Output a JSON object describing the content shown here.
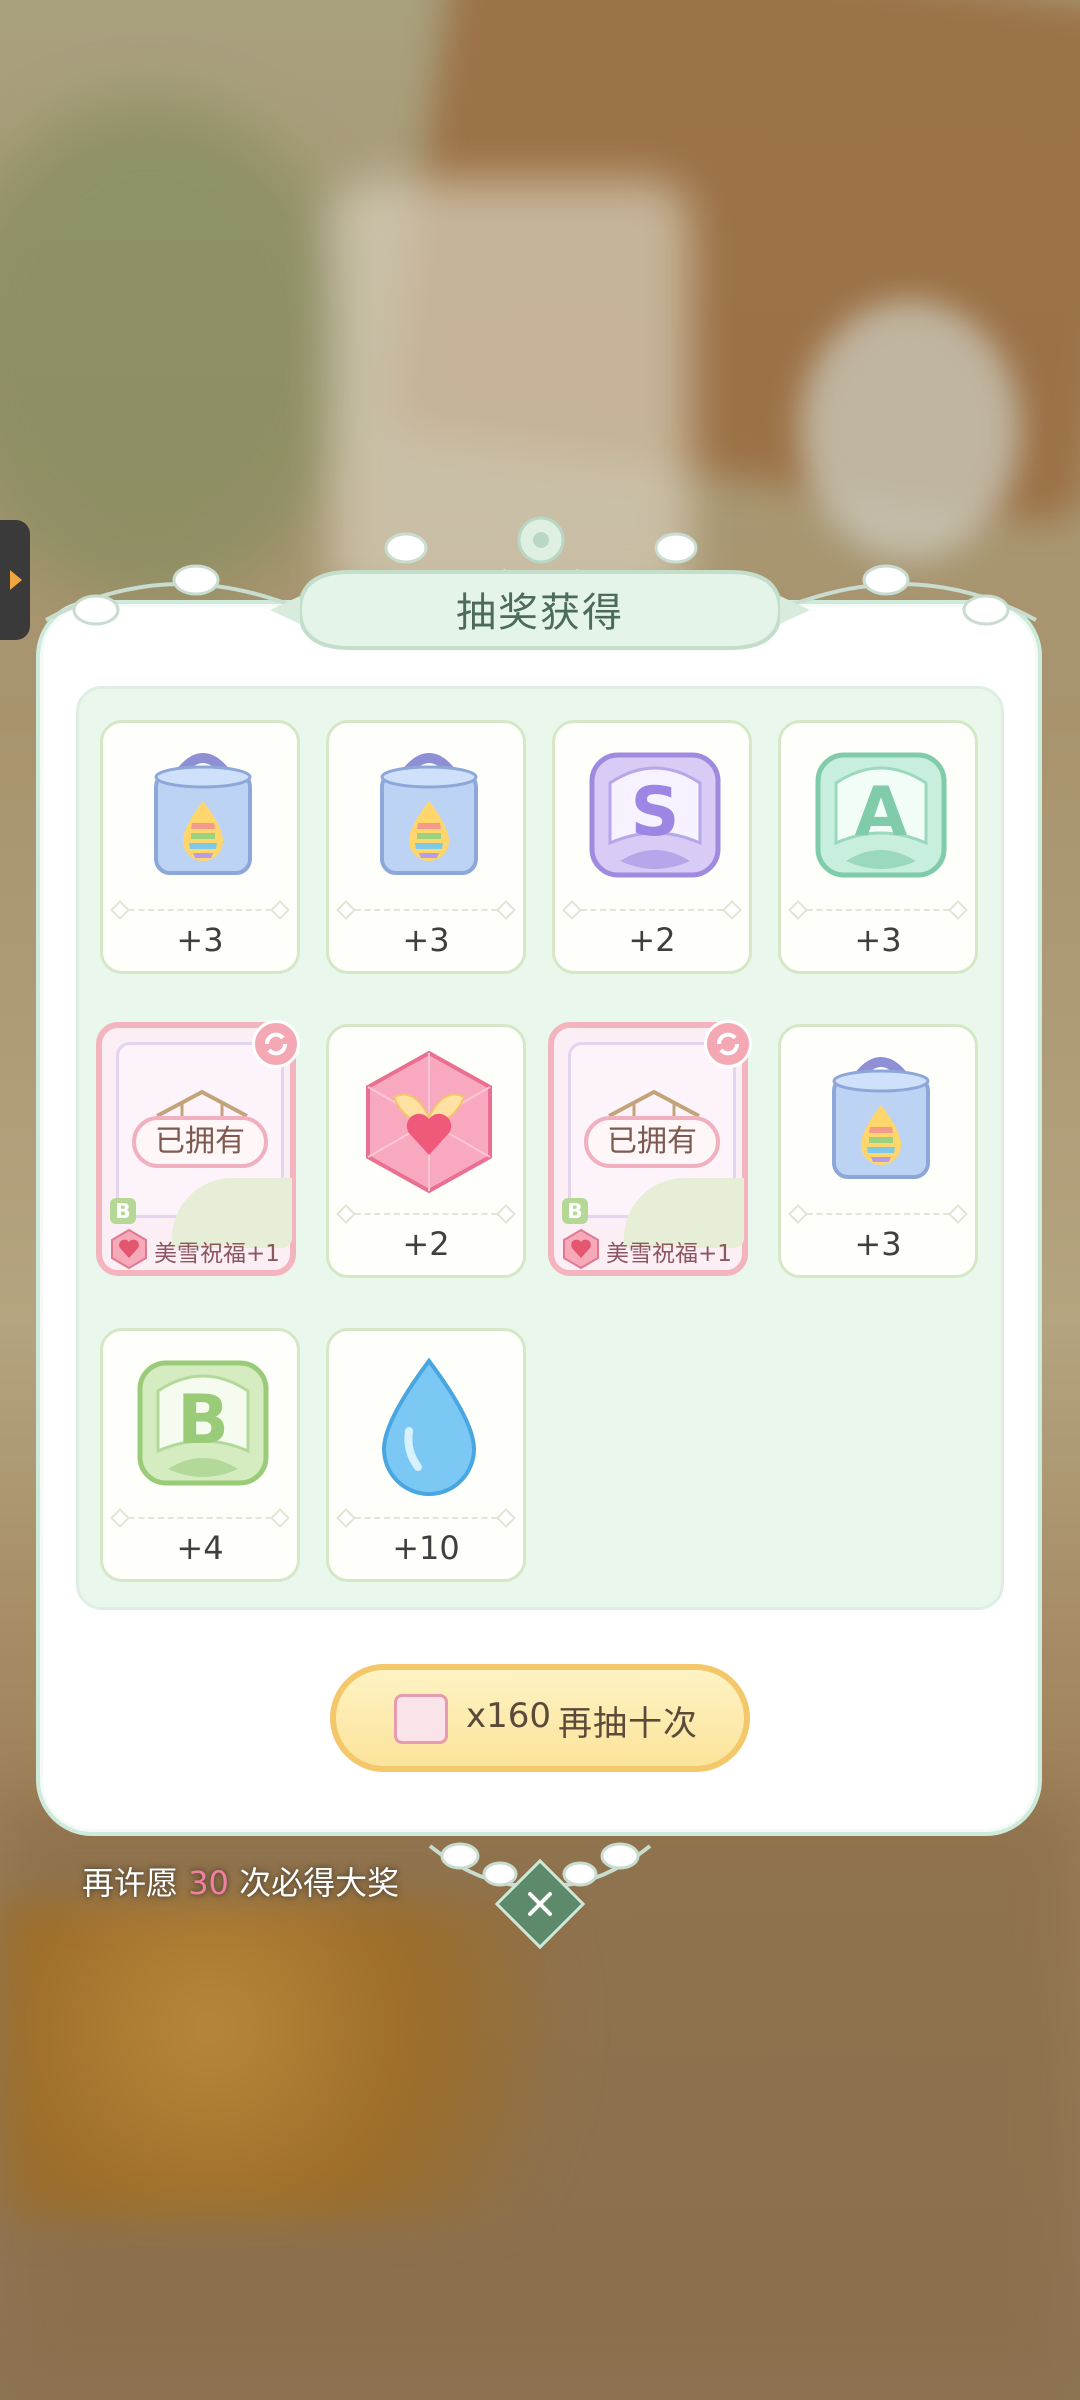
{
  "dialog": {
    "title": "抽奖获得"
  },
  "rewards": [
    {
      "type": "dye-box",
      "qty": "+3"
    },
    {
      "type": "dye-box",
      "qty": "+3"
    },
    {
      "type": "s-rank-crest",
      "qty": "+2"
    },
    {
      "type": "a-rank-crest",
      "qty": "+3"
    },
    {
      "type": "owned-outfit",
      "owned_label": "已拥有",
      "rank": "B",
      "bless_text": "美雪祝福+1"
    },
    {
      "type": "heart-crystal",
      "qty": "+2"
    },
    {
      "type": "owned-outfit",
      "owned_label": "已拥有",
      "rank": "B",
      "bless_text": "美雪祝福+1"
    },
    {
      "type": "dye-box",
      "qty": "+3"
    },
    {
      "type": "b-rank-crest",
      "qty": "+4"
    },
    {
      "type": "water-drop",
      "qty": "+10"
    }
  ],
  "redraw_button": {
    "cost": "x160",
    "label": "再抽十次",
    "icon": "ticket-icon"
  },
  "pity": {
    "prefix": "再许愿",
    "count": "30",
    "suffix": "次必得大奖"
  },
  "colors": {
    "accent_green": "#5d8a6b",
    "owned_pink": "#f4b4bd",
    "pity_number": "#f07fa0"
  }
}
